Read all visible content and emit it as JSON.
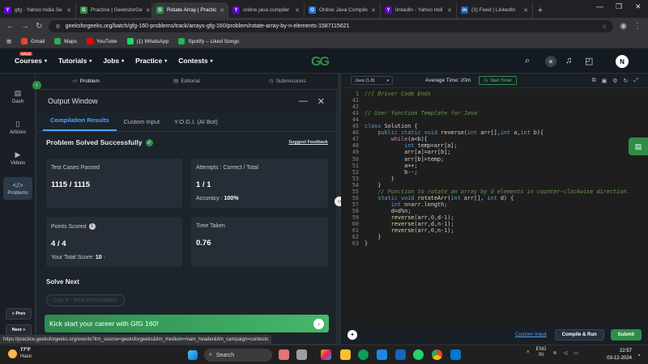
{
  "browser": {
    "tabs": [
      {
        "title": "gfg - Yahoo India Se",
        "fav": "Y",
        "color": "#6001d2",
        "active": false
      },
      {
        "title": "Practice | GeeksforGe",
        "fav": "G",
        "color": "#2f8d46",
        "active": false
      },
      {
        "title": "Rotate Array | Practic",
        "fav": "G",
        "color": "#2f8d46",
        "active": true
      },
      {
        "title": "online java compiler",
        "fav": "Y",
        "color": "#6001d2",
        "active": false
      },
      {
        "title": "Online Java Compile",
        "fav": "O",
        "color": "#1a73e8",
        "active": false
      },
      {
        "title": "linkedin - Yahoo Indi",
        "fav": "Y",
        "color": "#6001d2",
        "active": false
      },
      {
        "title": "(3) Feed | LinkedIn",
        "fav": "in",
        "color": "#0a66c2",
        "active": false
      }
    ],
    "url": "geeksforgeeks.org/batch/gfg-160-problems/track/arrays-gfg-160/problem/rotate-array-by-n-elements-1587115621",
    "bookmarks": [
      {
        "label": "Gmail",
        "color": "#ea4335"
      },
      {
        "label": "Maps",
        "color": "#34a853"
      },
      {
        "label": "YouTube",
        "color": "#ff0000"
      },
      {
        "label": "(1) WhatsApp",
        "color": "#25d366"
      },
      {
        "label": "Spotify – Liked Songs",
        "color": "#1db954"
      }
    ]
  },
  "header": {
    "menus": [
      "Courses",
      "Tutorials",
      "Jobs",
      "Practice",
      "Contests"
    ],
    "sale_badge": "SALE",
    "logo": "GG",
    "avatar_initial": "N"
  },
  "leftnav": {
    "items": [
      {
        "label": "Dash",
        "icon": "▤"
      },
      {
        "label": "Articles",
        "icon": "▯"
      },
      {
        "label": "Videos",
        "icon": "▶"
      },
      {
        "label": "Problems",
        "icon": "</>"
      }
    ],
    "prev": "« Prev",
    "next": "Next »"
  },
  "problem_tabs": [
    "Problem",
    "Editorial",
    "Submissions"
  ],
  "output": {
    "title": "Output Window",
    "tabs": [
      "Compilation Results",
      "Custom Input",
      "Y.O.G.I. (AI Bot)"
    ],
    "status": "Problem Solved Successfully",
    "feedback": "Suggest Feedback",
    "test_cases_label": "Test Cases Passed",
    "test_cases_value": "1115 / 1115",
    "attempts_label": "Attempts : Correct / Total",
    "attempts_value": "1 / 1",
    "accuracy_label": "Accuracy :",
    "accuracy_value": "100%",
    "points_label": "Points Scored",
    "points_value": "4 / 4",
    "total_score_label": "Your Total Score:",
    "total_score_value": "10",
    "time_label": "Time Taken",
    "time_value": "0.76",
    "solve_next": "Solve Next",
    "next_problem": "Day 5 - Next Permutation",
    "banner": "Kick start your career with GfG 160!"
  },
  "editor": {
    "language": "Java (1.8)",
    "avg_time": "Average Time: 20m",
    "start_timer": "Start Timer",
    "lines": [
      {
        "n": "1",
        "html": "<span class='cm'>//{ Driver Code Ends</span>"
      },
      {
        "n": "41",
        "html": ""
      },
      {
        "n": "42",
        "html": ""
      },
      {
        "n": "43",
        "html": "<span class='cm'>// User function Template for Java</span>"
      },
      {
        "n": "44",
        "html": ""
      },
      {
        "n": "45",
        "html": "<span class='ty'>class</span> Solution {"
      },
      {
        "n": "46",
        "html": "    <span class='ty'>public static void</span> <span class='fn'>reverse</span>(<span class='ty'>int</span> arr[],<span class='ty'>int</span> a,<span class='ty'>int</span> b){"
      },
      {
        "n": "47",
        "html": "        <span class='kw'>while</span>(a&lt;b){"
      },
      {
        "n": "48",
        "html": "            <span class='ty'>int</span> temp=arr[a];"
      },
      {
        "n": "49",
        "html": "            arr[a]=arr[b];"
      },
      {
        "n": "50",
        "html": "            arr[b]=temp;"
      },
      {
        "n": "51",
        "html": "            a++;"
      },
      {
        "n": "52",
        "html": "            b--;"
      },
      {
        "n": "53",
        "html": "        }"
      },
      {
        "n": "54",
        "html": "    }"
      },
      {
        "n": "55",
        "html": "    <span class='cm'>// Function to rotate an array by d elements in counter-clockwise direction.</span>"
      },
      {
        "n": "56",
        "html": "    <span class='ty'>static void</span> <span class='fn'>rotateArr</span>(<span class='ty'>int</span> arr[], <span class='ty'>int</span> d) {"
      },
      {
        "n": "57",
        "html": "        <span class='ty'>int</span> n=arr.length;"
      },
      {
        "n": "58",
        "html": "        d=d%n;"
      },
      {
        "n": "59",
        "html": "        <span class='fn'>reverse</span>(arr,<span class='nu'>0</span>,d-<span class='nu'>1</span>);"
      },
      {
        "n": "60",
        "html": "        <span class='fn'>reverse</span>(arr,d,n-<span class='nu'>1</span>);"
      },
      {
        "n": "61",
        "html": "        <span class='fn'>reverse</span>(arr,<span class='nu'>0</span>,n-<span class='nu'>1</span>);"
      },
      {
        "n": "62",
        "html": "    }"
      },
      {
        "n": "63",
        "html": "}"
      }
    ],
    "custom_input": "Custom Input",
    "compile": "Compile & Run",
    "submit": "Submit"
  },
  "status_url": "https://practice.geeksforgeeks.org/events?itm_source=geeksforgeeks&itm_medium=main_header&itm_campaign=contests",
  "taskbar": {
    "temp": "77°F",
    "weather": "Haze",
    "search": "Search",
    "lang": "ENG",
    "region": "IN",
    "time": "22:57",
    "date": "03-12-2024"
  }
}
